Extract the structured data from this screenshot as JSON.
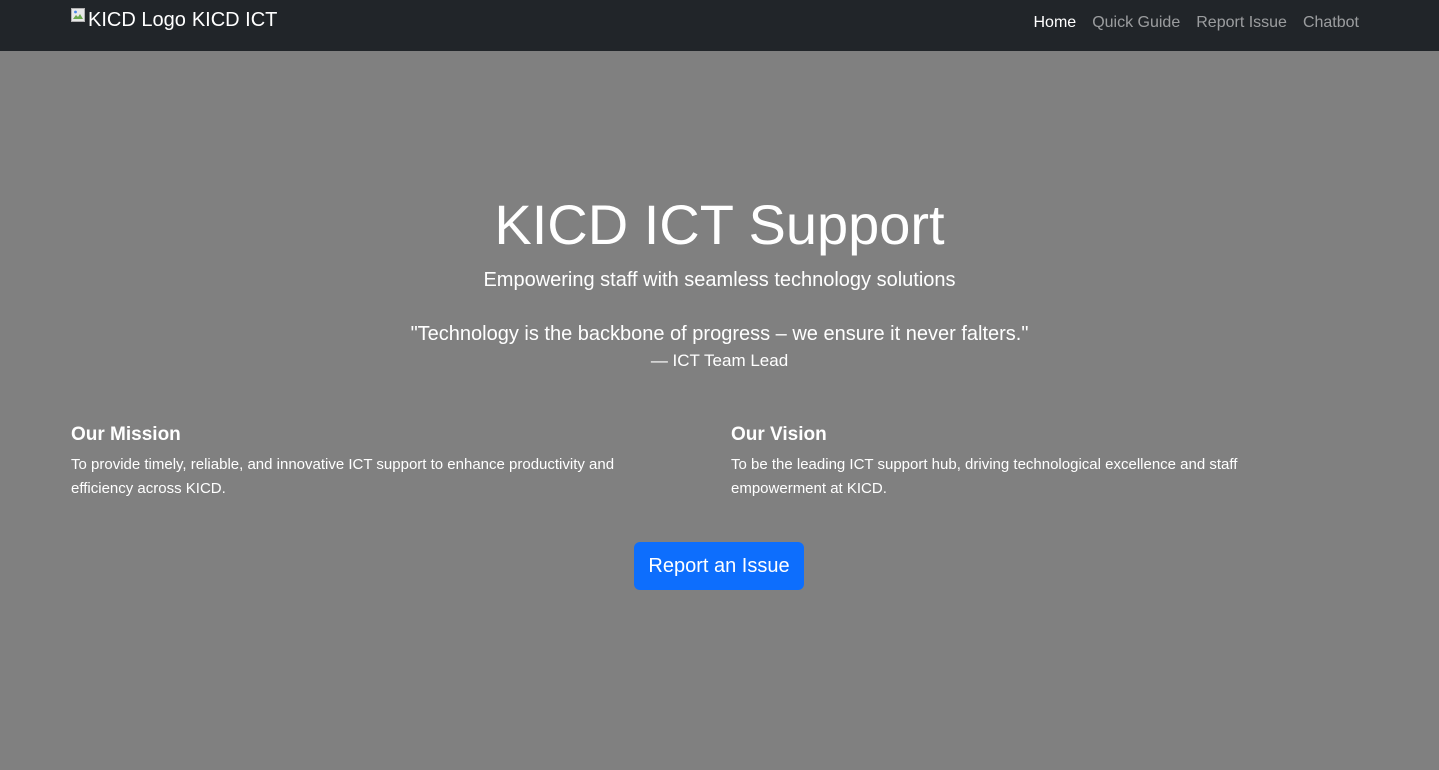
{
  "navbar": {
    "logo_alt": "KICD Logo",
    "brand": "KICD ICT",
    "links": [
      {
        "label": "Home",
        "active": true
      },
      {
        "label": "Quick Guide",
        "active": false
      },
      {
        "label": "Report Issue",
        "active": false
      },
      {
        "label": "Chatbot",
        "active": false
      }
    ]
  },
  "hero": {
    "title": "KICD ICT Support",
    "subtitle": "Empowering staff with seamless technology solutions",
    "quote": "\"Technology is the backbone of progress – we ensure it never falters.\"",
    "quote_author": "— ICT Team Lead"
  },
  "mission": {
    "heading": "Our Mission",
    "text": "To provide timely, reliable, and innovative ICT support to enhance productivity and efficiency across KICD."
  },
  "vision": {
    "heading": "Our Vision",
    "text": "To be the leading ICT support hub, driving technological excellence and staff empowerment at KICD."
  },
  "cta": {
    "label": "Report an Issue"
  },
  "colors": {
    "navbar_bg": "#212529",
    "page_bg": "#808080",
    "accent": "#0d6efd"
  },
  "icons": {
    "logo": "broken-image-icon"
  }
}
